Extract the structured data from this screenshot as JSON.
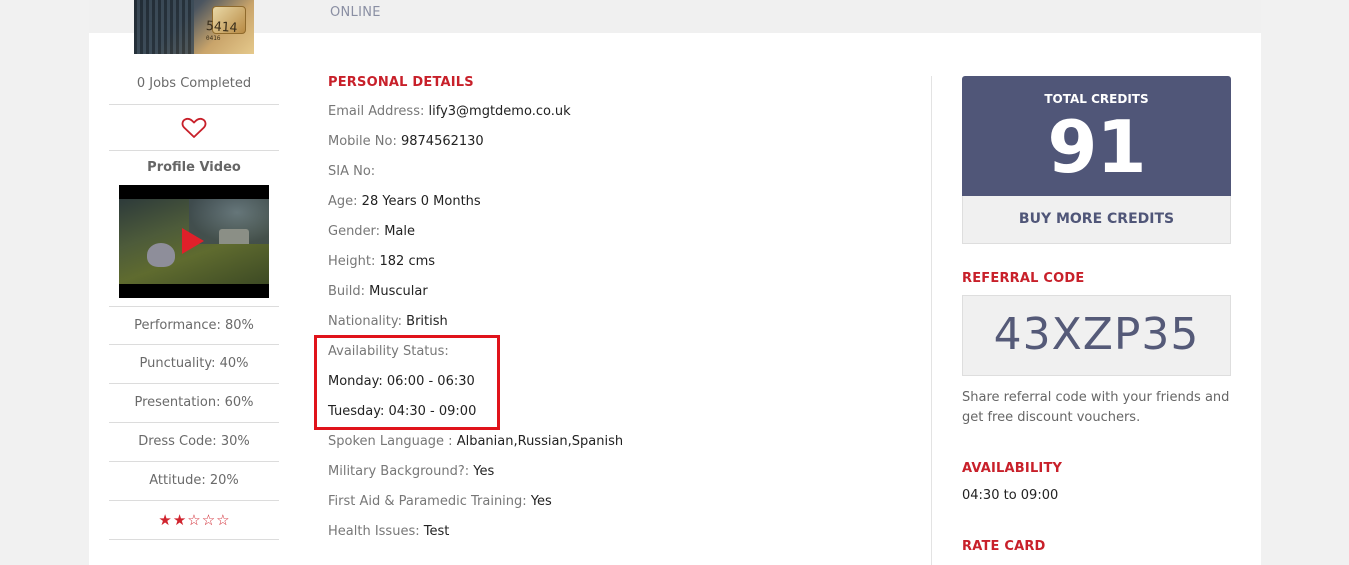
{
  "header": {
    "status": "ONLINE"
  },
  "avatar": {
    "card_digits": "5414",
    "card_sub": "0416"
  },
  "sidebar": {
    "jobs_completed": "0 Jobs Completed",
    "profile_video_title": "Profile Video",
    "ratings": [
      "Performance: 80%",
      "Punctuality: 40%",
      "Presentation: 60%",
      "Dress Code: 30%",
      "Attitude: 20%"
    ],
    "stars": {
      "filled": 2,
      "total": 5,
      "filled_glyph": "★",
      "empty_glyph": "☆"
    }
  },
  "personal_details": {
    "title": "PERSONAL DETAILS",
    "email_label": "Email Address:",
    "email_value": "lify3@mgtdemo.co.uk",
    "mobile_label": "Mobile No:",
    "mobile_value": "9874562130",
    "sia_label": "SIA No:",
    "sia_value": "",
    "age_label": "Age:",
    "age_value": "28 Years 0 Months",
    "gender_label": "Gender:",
    "gender_value": "Male",
    "height_label": "Height:",
    "height_value": "182 cms",
    "build_label": "Build:",
    "build_value": "Muscular",
    "nationality_label": "Nationality:",
    "nationality_value": "British",
    "availability_label": "Availability Status:",
    "availability": [
      "Monday: 06:00 - 06:30",
      "Tuesday: 04:30 - 09:00"
    ],
    "language_label": "Spoken Language :",
    "language_value": "Albanian,Russian,Spanish",
    "military_label": "Military Background?:",
    "military_value": "Yes",
    "firstaid_label": "First Aid & Paramedic Training:",
    "firstaid_value": "Yes",
    "health_label": "Health Issues:",
    "health_value": "Test"
  },
  "credits": {
    "label": "TOTAL CREDITS",
    "value": "91",
    "buy_button": "BUY MORE CREDITS"
  },
  "referral": {
    "title": "REFERRAL CODE",
    "code": "43XZP35",
    "note": "Share referral code with your friends and get free discount vouchers."
  },
  "availability_section": {
    "title": "AVAILABILITY",
    "value": "04:30 to 09:00"
  },
  "rate_card": {
    "title": "RATE CARD"
  },
  "colors": {
    "accent": "#c8202a",
    "credits_bg": "#505678",
    "highlight": "#e0131b"
  }
}
